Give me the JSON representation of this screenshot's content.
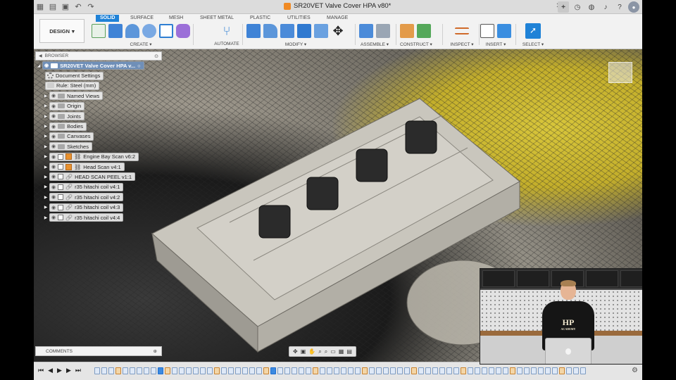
{
  "titlebar": {
    "document_title": "SR20VET Valve Cover HPA v80*",
    "icons": [
      "grid-icon",
      "file-icon",
      "save-icon",
      "undo-icon",
      "redo-icon"
    ],
    "right_icons": [
      "new-tab-icon",
      "clock-icon",
      "globe-icon",
      "bell-icon",
      "help-icon",
      "avatar-icon"
    ]
  },
  "toolbar": {
    "workspace": "DESIGN",
    "tabs": [
      "SOLID",
      "SURFACE",
      "MESH",
      "SHEET METAL",
      "PLASTIC",
      "UTILITIES",
      "MANAGE"
    ],
    "active_tab": "SOLID",
    "groups": [
      "CREATE ▾",
      "AUTOMATE ▾",
      "MODIFY ▾",
      "ASSEMBLE ▾",
      "CONSTRUCT ▾",
      "INSPECT ▾",
      "INSERT ▾",
      "SELECT ▾"
    ],
    "accent": "#1f82d7"
  },
  "browser": {
    "title": "BROWSER",
    "root": "SR20VET Valve Cover HPA v...",
    "items": [
      {
        "label": "Document Settings",
        "icon": "gear-icon"
      },
      {
        "label": "Rule: Steel (mm)",
        "icon": "rule-icon"
      },
      {
        "label": "Named Views",
        "icon": "folder-icon"
      },
      {
        "label": "Origin",
        "icon": "folder-icon"
      },
      {
        "label": "Joints",
        "icon": "folder-icon"
      },
      {
        "label": "Bodies",
        "icon": "folder-icon"
      },
      {
        "label": "Canvases",
        "icon": "folder-icon"
      },
      {
        "label": "Sketches",
        "icon": "folder-icon"
      },
      {
        "label": "Engine Bay Scan v6:2",
        "icon": "component-icon"
      },
      {
        "label": "Head Scan v4:1",
        "icon": "component-icon"
      },
      {
        "label": "HEAD SCAN PEEL v1:1",
        "icon": "link-icon"
      },
      {
        "label": "r35 hitachi coil v4:1",
        "icon": "link-icon"
      },
      {
        "label": "r35 hitachi coil v4:2",
        "icon": "link-icon"
      },
      {
        "label": "r35 hitachi coil v4:3",
        "icon": "link-icon"
      },
      {
        "label": "r35 hitachi coil v4:4",
        "icon": "link-icon"
      }
    ]
  },
  "comments": {
    "label": "COMMENTS"
  },
  "navbar": {
    "icons": [
      "orbit-icon",
      "look-at-icon",
      "pan-icon",
      "zoom-icon",
      "fit-icon",
      "display-settings-icon",
      "grid-settings-icon",
      "viewports-icon"
    ]
  },
  "webcam": {
    "shirt_text": "HP",
    "shirt_sub": "ACADEMY"
  }
}
